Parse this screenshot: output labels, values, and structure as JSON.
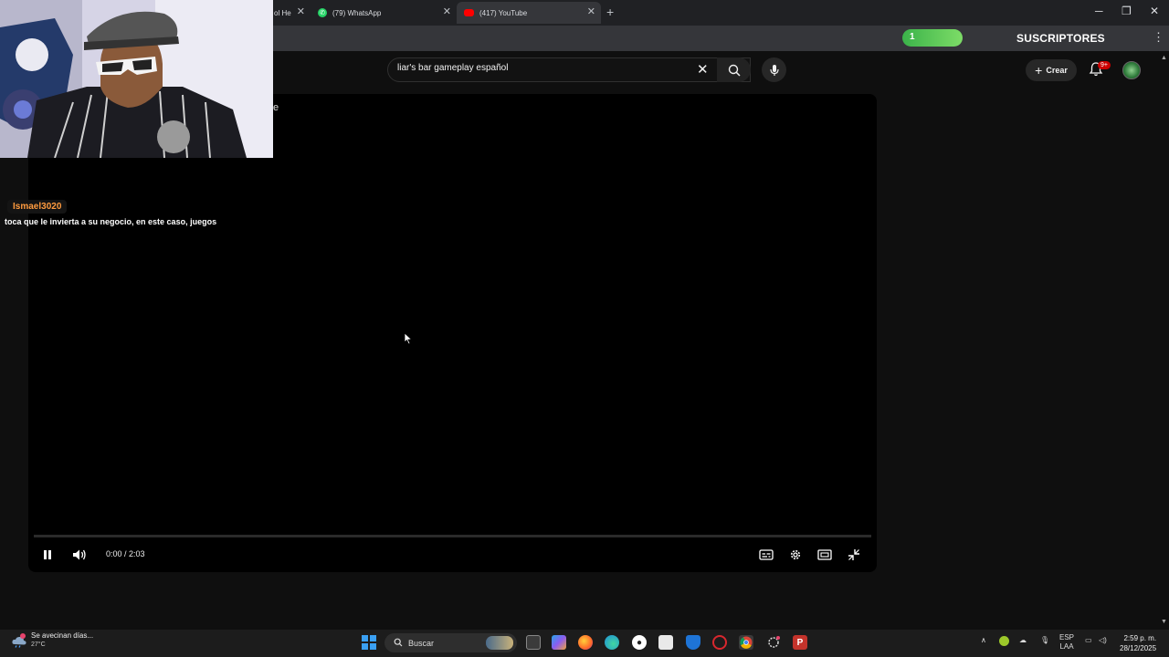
{
  "browser": {
    "tabs": [
      {
        "label": "ol He",
        "close": "✕"
      },
      {
        "label": "(79) WhatsApp",
        "close": "✕"
      },
      {
        "label": "(417) YouTube",
        "close": "✕"
      }
    ],
    "new_tab": "+",
    "window_controls": {
      "minimize": "─",
      "maximize": "❐",
      "close": "✕"
    },
    "menu": "⋮"
  },
  "extension": {
    "counter_value": "1",
    "label": "SUSCRIPTORES"
  },
  "youtube": {
    "search": {
      "value": "liar's bar gameplay español",
      "clear": "✕"
    },
    "create_label": "Crear",
    "create_plus": "+",
    "notifications_badge": "9+"
  },
  "player": {
    "title_fragment": "e",
    "time_display": "0:00 / 2:03",
    "progress_fraction": 0
  },
  "chat": {
    "username": "Ismael3020",
    "message": "toca que le invierta a su negocio, en este caso, juegos"
  },
  "taskbar": {
    "weather_text": "Se avecinan días...",
    "weather_temp": "27°C",
    "search_placeholder": "Buscar",
    "language_top": "ESP",
    "language_bottom": "LAA",
    "time": "2:59 p. m.",
    "date": "28/12/2025"
  },
  "colors": {
    "accent_green": "#3bb34a",
    "chat_username": "#ff9b3f",
    "youtube_red": "#cc0000"
  }
}
